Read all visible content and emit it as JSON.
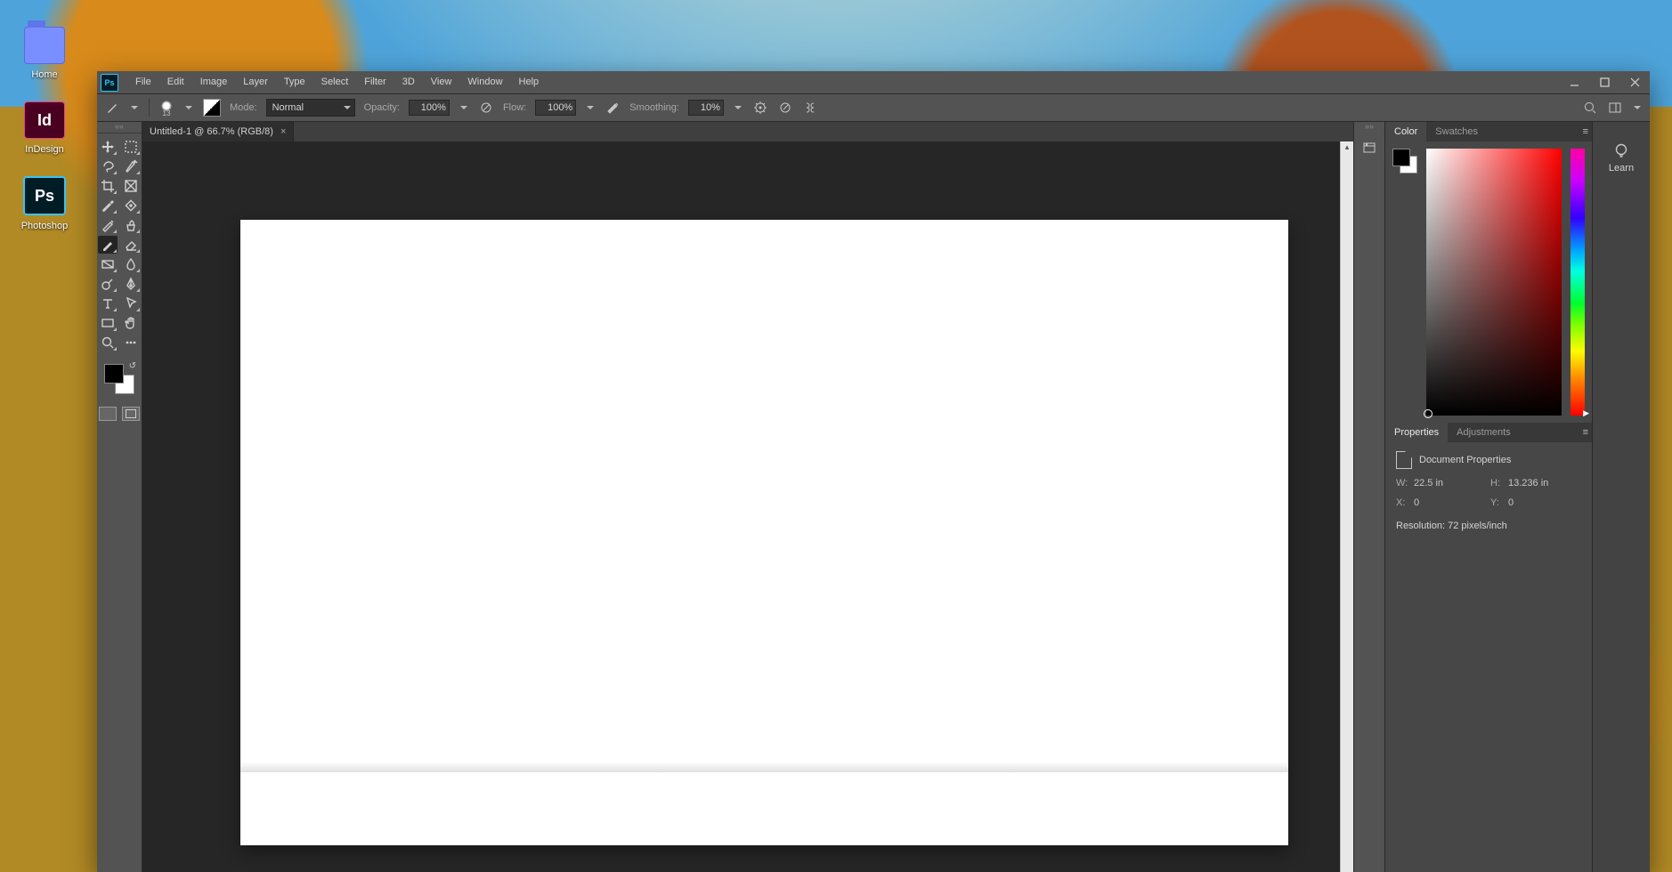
{
  "desktop": {
    "icons": {
      "home": {
        "label": "Home"
      },
      "indesign": {
        "label": "InDesign",
        "badge": "Id"
      },
      "photoshop": {
        "label": "Photoshop",
        "badge": "Ps"
      }
    }
  },
  "app": {
    "badge": "Ps",
    "menus": [
      "File",
      "Edit",
      "Image",
      "Layer",
      "Type",
      "Select",
      "Filter",
      "3D",
      "View",
      "Window",
      "Help"
    ]
  },
  "options": {
    "brush_size": "13",
    "mode_label": "Mode:",
    "mode_value": "Normal",
    "opacity_label": "Opacity:",
    "opacity_value": "100%",
    "flow_label": "Flow:",
    "flow_value": "100%",
    "smoothing_label": "Smoothing:",
    "smoothing_value": "10%"
  },
  "document": {
    "tab_title": "Untitled-1 @ 66.7% (RGB/8)"
  },
  "tools": {
    "left": [
      [
        "move-tool",
        "marquee-tool"
      ],
      [
        "lasso-tool",
        "quick-select-tool"
      ],
      [
        "crop-tool",
        "frame-tool"
      ],
      [
        "eyedropper-tool",
        "ruler-tool"
      ],
      [
        "healing-tool",
        "clone-tool"
      ],
      [
        "brush-tool",
        "eraser-tool"
      ],
      [
        "gradient-tool",
        "blur-tool"
      ],
      [
        "dodge-tool",
        "pen-tool"
      ],
      [
        "type-tool",
        "path-select-tool"
      ],
      [
        "rectangle-tool",
        "hand-tool"
      ],
      [
        "zoom-tool",
        "more-tools"
      ]
    ],
    "selected": "brush-tool"
  },
  "panels": {
    "color": {
      "tab1": "Color",
      "tab2": "Swatches"
    },
    "properties": {
      "tab1": "Properties",
      "tab2": "Adjustments",
      "heading": "Document Properties",
      "w_label": "W:",
      "w_value": "22.5 in",
      "h_label": "H:",
      "h_value": "13.236 in",
      "x_label": "X:",
      "x_value": "0",
      "y_label": "Y:",
      "y_value": "0",
      "res_label": "Resolution:",
      "res_value": "72 pixels/inch"
    },
    "learn_label": "Learn"
  }
}
